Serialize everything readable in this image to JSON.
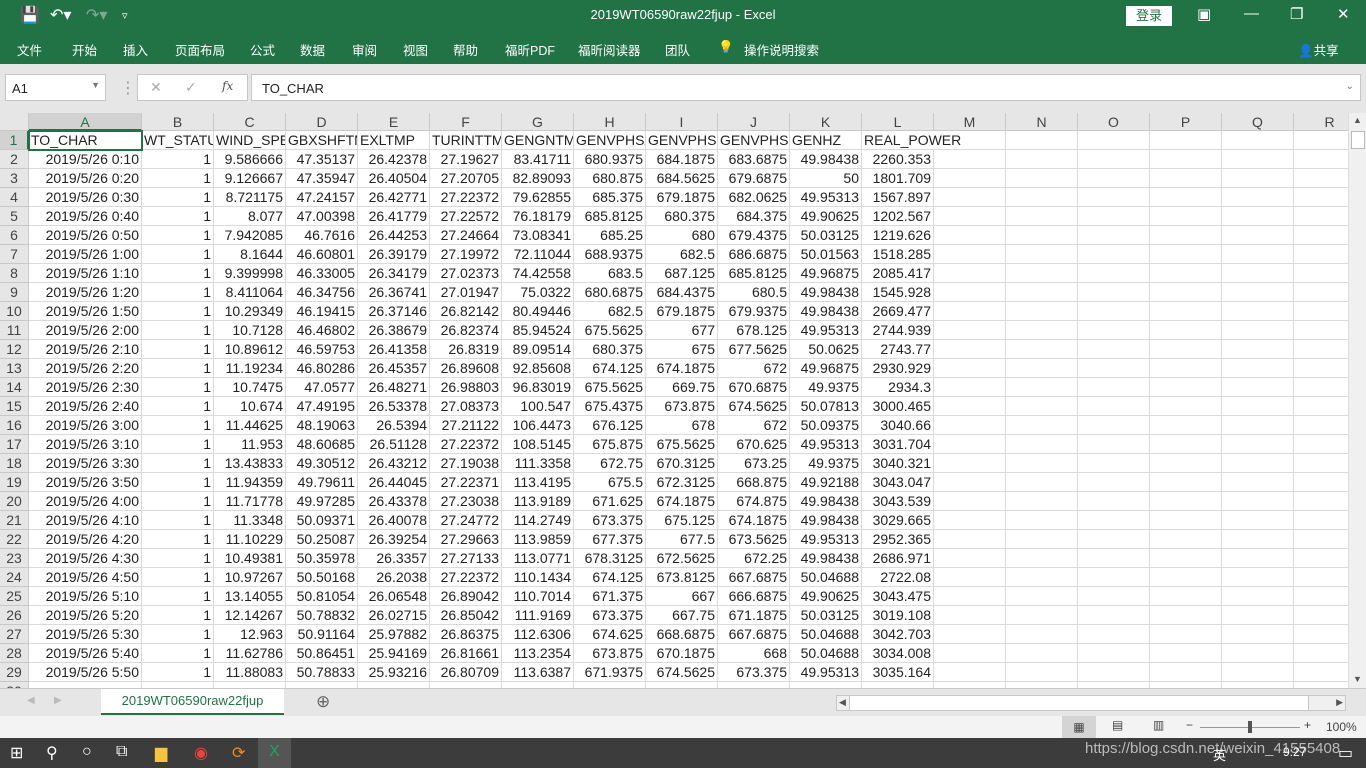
{
  "window": {
    "title": "2019WT06590raw22fjup  -  Excel",
    "login": "登录"
  },
  "ribbon": {
    "tabs": [
      "文件",
      "开始",
      "插入",
      "页面布局",
      "公式",
      "数据",
      "审阅",
      "视图",
      "帮助",
      "福昕PDF",
      "福昕阅读器",
      "团队"
    ],
    "search": "操作说明搜索",
    "share": "共享"
  },
  "formula_bar": {
    "name_box": "A1",
    "formula": "TO_CHAR",
    "fx": "fx"
  },
  "sheet": {
    "columns": [
      "A",
      "B",
      "C",
      "D",
      "E",
      "F",
      "G",
      "H",
      "I",
      "J",
      "K",
      "L",
      "M",
      "N",
      "O",
      "P",
      "Q",
      "R"
    ],
    "headers": [
      "TO_CHAR",
      "WT_STATUS",
      "WIND_SPEED",
      "GBXSHFTMP",
      "EXLTMP",
      "TURINTTMP",
      "GENGNTMP",
      "GENVPHSA",
      "GENVPHSB",
      "GENVPHSC",
      "GENHZ",
      "REAL_POWER"
    ],
    "rows": [
      [
        "2019/5/26 0:10",
        "1",
        "9.586666",
        "47.35137",
        "26.42378",
        "27.19627",
        "83.41711",
        "680.9375",
        "684.1875",
        "683.6875",
        "49.98438",
        "2260.353"
      ],
      [
        "2019/5/26 0:20",
        "1",
        "9.126667",
        "47.35947",
        "26.40504",
        "27.20705",
        "82.89093",
        "680.875",
        "684.5625",
        "679.6875",
        "50",
        "1801.709"
      ],
      [
        "2019/5/26 0:30",
        "1",
        "8.721175",
        "47.24157",
        "26.42771",
        "27.22372",
        "79.62855",
        "685.375",
        "679.1875",
        "682.0625",
        "49.95313",
        "1567.897"
      ],
      [
        "2019/5/26 0:40",
        "1",
        "8.077",
        "47.00398",
        "26.41779",
        "27.22572",
        "76.18179",
        "685.8125",
        "680.375",
        "684.375",
        "49.90625",
        "1202.567"
      ],
      [
        "2019/5/26 0:50",
        "1",
        "7.942085",
        "46.7616",
        "26.44253",
        "27.24664",
        "73.08341",
        "685.25",
        "680",
        "679.4375",
        "50.03125",
        "1219.626"
      ],
      [
        "2019/5/26 1:00",
        "1",
        "8.1644",
        "46.60801",
        "26.39179",
        "27.19972",
        "72.11044",
        "688.9375",
        "682.5",
        "686.6875",
        "50.01563",
        "1518.285"
      ],
      [
        "2019/5/26 1:10",
        "1",
        "9.399998",
        "46.33005",
        "26.34179",
        "27.02373",
        "74.42558",
        "683.5",
        "687.125",
        "685.8125",
        "49.96875",
        "2085.417"
      ],
      [
        "2019/5/26 1:20",
        "1",
        "8.411064",
        "46.34756",
        "26.36741",
        "27.01947",
        "75.0322",
        "680.6875",
        "684.4375",
        "680.5",
        "49.98438",
        "1545.928"
      ],
      [
        "2019/5/26 1:50",
        "1",
        "10.29349",
        "46.19415",
        "26.37146",
        "26.82142",
        "80.49446",
        "682.5",
        "679.1875",
        "679.9375",
        "49.98438",
        "2669.477"
      ],
      [
        "2019/5/26 2:00",
        "1",
        "10.7128",
        "46.46802",
        "26.38679",
        "26.82374",
        "85.94524",
        "675.5625",
        "677",
        "678.125",
        "49.95313",
        "2744.939"
      ],
      [
        "2019/5/26 2:10",
        "1",
        "10.89612",
        "46.59753",
        "26.41358",
        "26.8319",
        "89.09514",
        "680.375",
        "675",
        "677.5625",
        "50.0625",
        "2743.77"
      ],
      [
        "2019/5/26 2:20",
        "1",
        "11.19234",
        "46.80286",
        "26.45357",
        "26.89608",
        "92.85608",
        "674.125",
        "674.1875",
        "672",
        "49.96875",
        "2930.929"
      ],
      [
        "2019/5/26 2:30",
        "1",
        "10.7475",
        "47.0577",
        "26.48271",
        "26.98803",
        "96.83019",
        "675.5625",
        "669.75",
        "670.6875",
        "49.9375",
        "2934.3"
      ],
      [
        "2019/5/26 2:40",
        "1",
        "10.674",
        "47.49195",
        "26.53378",
        "27.08373",
        "100.547",
        "675.4375",
        "673.875",
        "674.5625",
        "50.07813",
        "3000.465"
      ],
      [
        "2019/5/26 3:00",
        "1",
        "11.44625",
        "48.19063",
        "26.5394",
        "27.21122",
        "106.4473",
        "676.125",
        "678",
        "672",
        "50.09375",
        "3040.66"
      ],
      [
        "2019/5/26 3:10",
        "1",
        "11.953",
        "48.60685",
        "26.51128",
        "27.22372",
        "108.5145",
        "675.875",
        "675.5625",
        "670.625",
        "49.95313",
        "3031.704"
      ],
      [
        "2019/5/26 3:30",
        "1",
        "13.43833",
        "49.30512",
        "26.43212",
        "27.19038",
        "111.3358",
        "672.75",
        "670.3125",
        "673.25",
        "49.9375",
        "3040.321"
      ],
      [
        "2019/5/26 3:50",
        "1",
        "11.94359",
        "49.79611",
        "26.44045",
        "27.22371",
        "113.4195",
        "675.5",
        "672.3125",
        "668.875",
        "49.92188",
        "3043.047"
      ],
      [
        "2019/5/26 4:00",
        "1",
        "11.71778",
        "49.97285",
        "26.43378",
        "27.23038",
        "113.9189",
        "671.625",
        "674.1875",
        "674.875",
        "49.98438",
        "3043.539"
      ],
      [
        "2019/5/26 4:10",
        "1",
        "11.3348",
        "50.09371",
        "26.40078",
        "27.24772",
        "114.2749",
        "673.375",
        "675.125",
        "674.1875",
        "49.98438",
        "3029.665"
      ],
      [
        "2019/5/26 4:20",
        "1",
        "11.10229",
        "50.25087",
        "26.39254",
        "27.29663",
        "113.9859",
        "677.375",
        "677.5",
        "673.5625",
        "49.95313",
        "2952.365"
      ],
      [
        "2019/5/26 4:30",
        "1",
        "10.49381",
        "50.35978",
        "26.3357",
        "27.27133",
        "113.0771",
        "678.3125",
        "672.5625",
        "672.25",
        "49.98438",
        "2686.971"
      ],
      [
        "2019/5/26 4:50",
        "1",
        "10.97267",
        "50.50168",
        "26.2038",
        "27.22372",
        "110.1434",
        "674.125",
        "673.8125",
        "667.6875",
        "50.04688",
        "2722.08"
      ],
      [
        "2019/5/26 5:10",
        "1",
        "13.14055",
        "50.81054",
        "26.06548",
        "26.89042",
        "110.7014",
        "671.375",
        "667",
        "666.6875",
        "49.90625",
        "3043.475"
      ],
      [
        "2019/5/26 5:20",
        "1",
        "12.14267",
        "50.78832",
        "26.02715",
        "26.85042",
        "111.9169",
        "673.375",
        "667.75",
        "671.1875",
        "50.03125",
        "3019.108"
      ],
      [
        "2019/5/26 5:30",
        "1",
        "12.963",
        "50.91164",
        "25.97882",
        "26.86375",
        "112.6306",
        "674.625",
        "668.6875",
        "667.6875",
        "50.04688",
        "3042.703"
      ],
      [
        "2019/5/26 5:40",
        "1",
        "11.62786",
        "50.86451",
        "25.94169",
        "26.81661",
        "113.2354",
        "673.875",
        "670.1875",
        "668",
        "50.04688",
        "3034.008"
      ],
      [
        "2019/5/26 5:50",
        "1",
        "11.88083",
        "50.78833",
        "25.93216",
        "26.80709",
        "113.6387",
        "671.9375",
        "674.5625",
        "673.375",
        "49.95313",
        "3035.164"
      ]
    ],
    "active_cell": "A1"
  },
  "sheet_tabs": {
    "active": "2019WT06590raw22fjup"
  },
  "status": {
    "zoom": "100%"
  },
  "taskbar": {
    "time": "9:27",
    "ime": "英",
    "watermark": "https://blog.csdn.net/weixin_41555408"
  },
  "colors": {
    "accent": "#217346"
  }
}
